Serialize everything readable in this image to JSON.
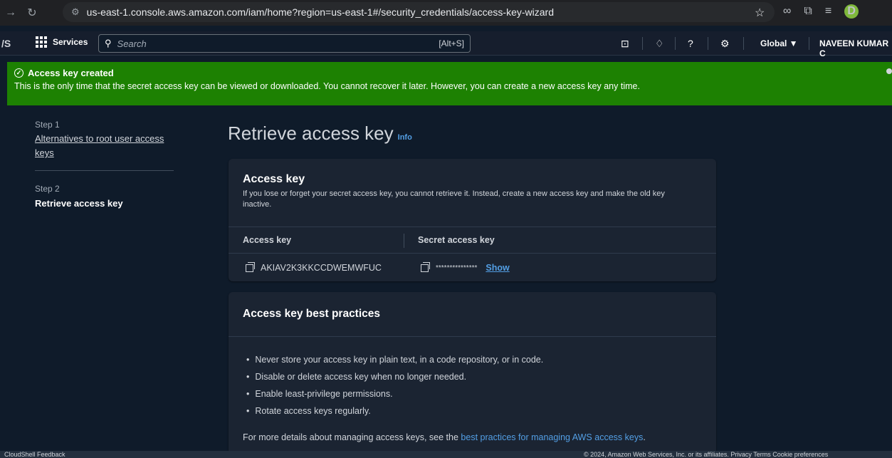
{
  "browser": {
    "url": "us-east-1.console.aws.amazon.com/iam/home?region=us-east-1#/security_credentials/access-key-wizard",
    "profile_initial": "D",
    "back_icon": "arrow-forward-icon",
    "reload_icon": "reload-icon"
  },
  "aws_nav": {
    "logo": "/S",
    "services_label": "Services",
    "search_placeholder": "Search",
    "search_shortcut": "[Alt+S]",
    "region_label": "Global ▼",
    "user_label": "NAVEEN KUMAR C"
  },
  "flash": {
    "title": "Access key created",
    "body": "This is the only time that the secret access key can be viewed or downloaded. You cannot recover it later. However, you can create a new access key any time.",
    "color": "#1d8102"
  },
  "steps": {
    "step1_label": "Step 1",
    "step1_title": "Alternatives to root user access keys",
    "step2_label": "Step 2",
    "step2_title": "Retrieve access key"
  },
  "main": {
    "title": "Retrieve access key",
    "info": "Info",
    "access_key_panel": {
      "title": "Access key",
      "description": "If you lose or forget your secret access key, you cannot retrieve it. Instead, create a new access key and make the old key inactive.",
      "col_access_key": "Access key",
      "col_secret_key": "Secret access key",
      "access_key_value": "AKIAV2K3KKCCDWEMWFUC",
      "secret_masked": "***************",
      "show_label": "Show"
    },
    "best_practices": {
      "title": "Access key best practices",
      "items": [
        "Never store your access key in plain text, in a code repository, or in code.",
        "Disable or delete access key when no longer needed.",
        "Enable least-privilege permissions.",
        "Rotate access keys regularly."
      ],
      "more_prefix": "For more details about managing access keys, see the ",
      "more_link": "best practices for managing AWS access keys",
      "more_suffix": "."
    }
  },
  "footer": {
    "left": "CloudShell   Feedback",
    "right": "© 2024, Amazon Web Services, Inc. or its affiliates.   Privacy   Terms   Cookie preferences"
  },
  "colors": {
    "accent_link": "#539fe5",
    "panel_bg": "#1b2432",
    "page_bg": "#0f1b2a",
    "nav_bg": "#161e2d"
  }
}
